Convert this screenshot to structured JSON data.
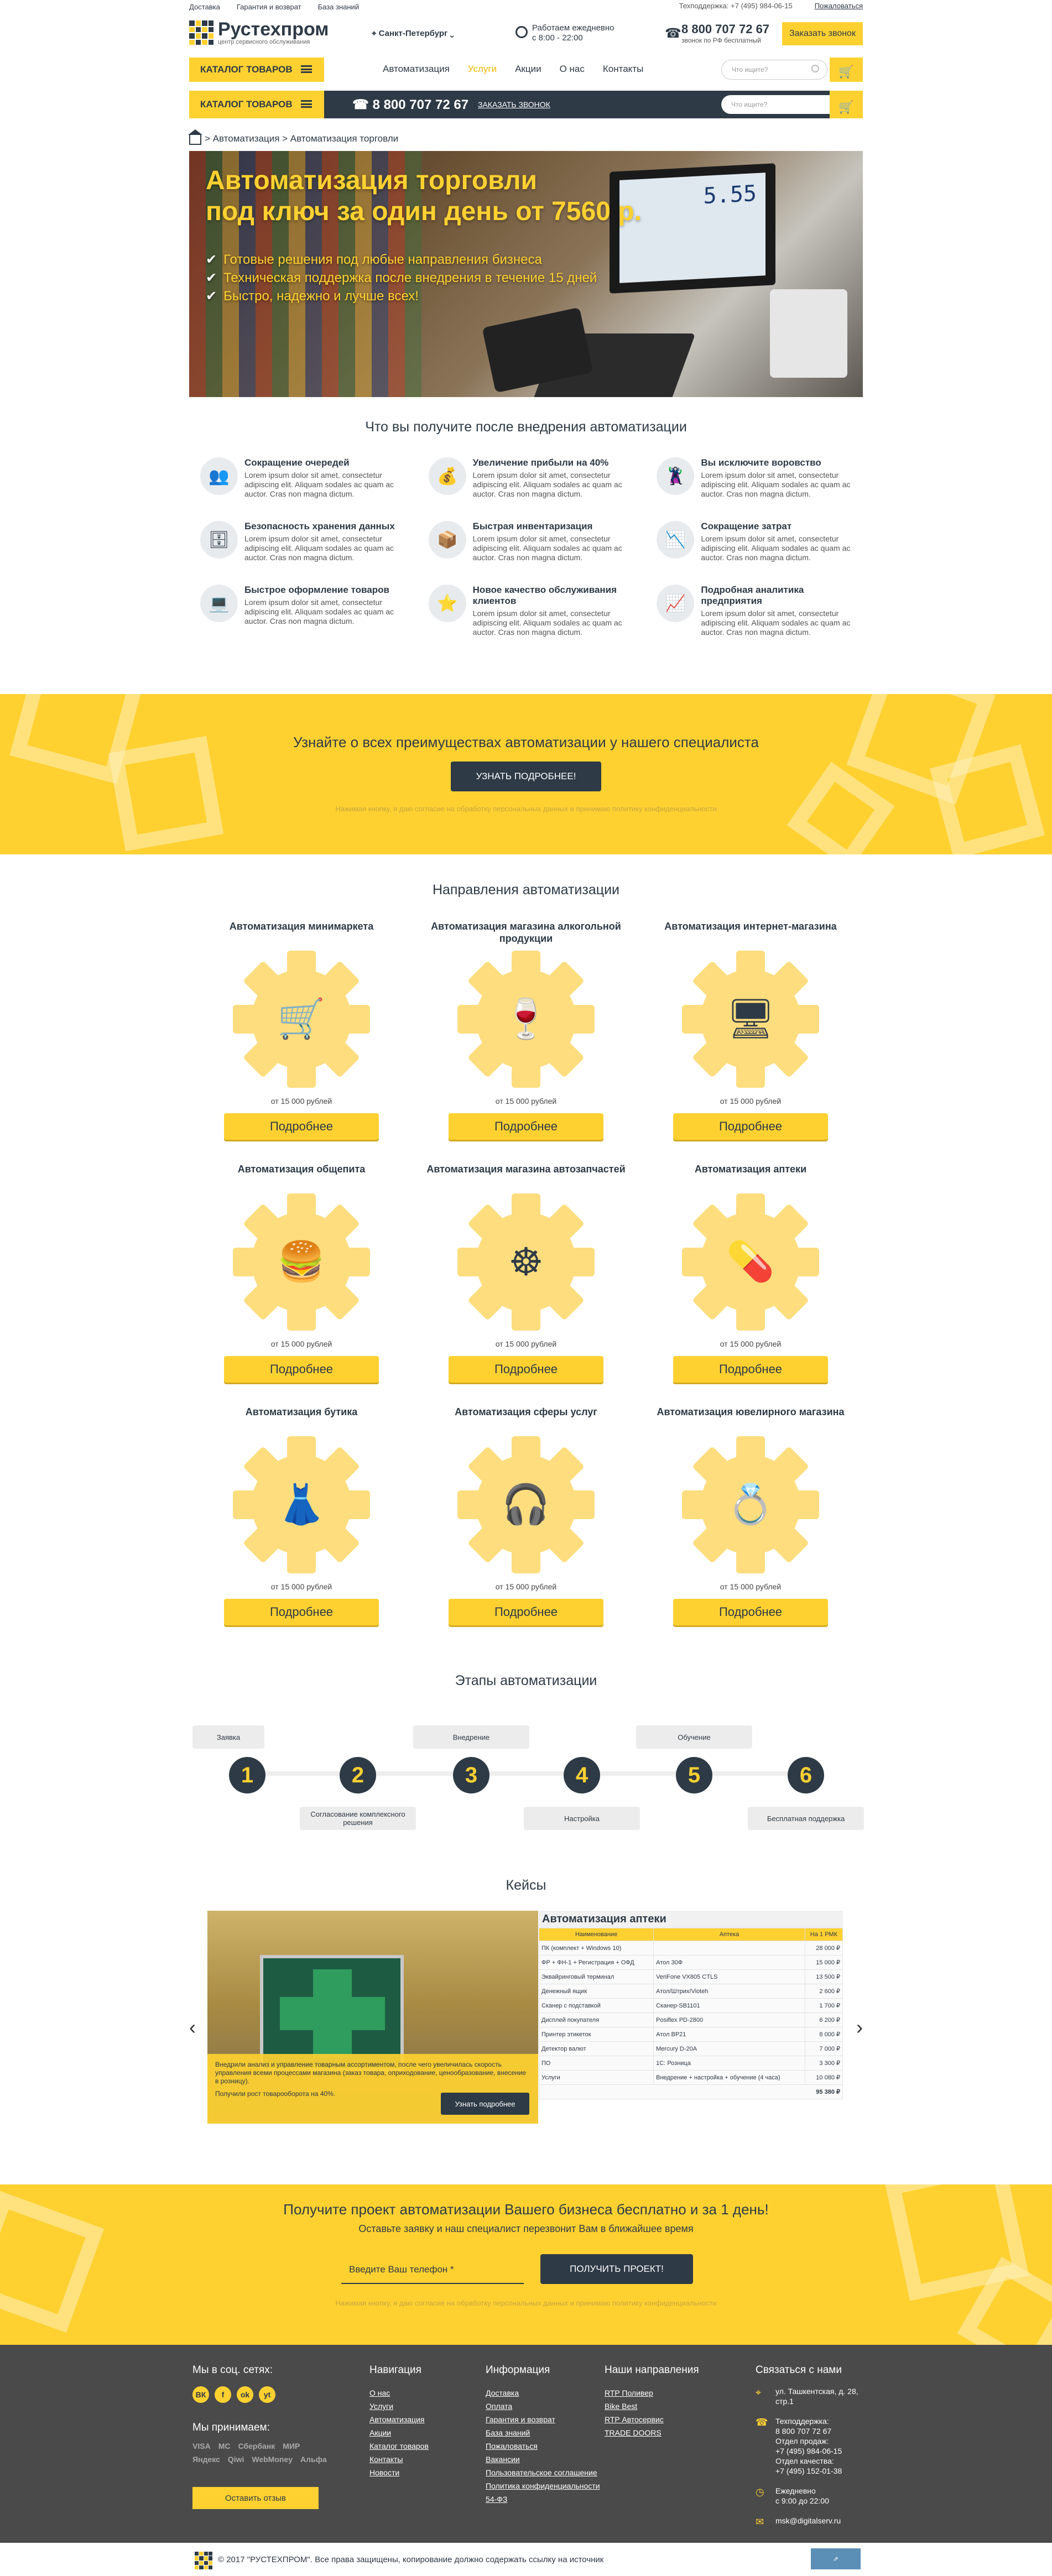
{
  "topbar": {
    "links": [
      "Доставка",
      "Гарантия и возврат",
      "База знаний"
    ],
    "support": "Техподдержка: +7 (495) 984-06-15",
    "complain": "Пожаловаться"
  },
  "header": {
    "logo_title": "Рустехпром",
    "logo_sub": "центр сервисного обслуживания",
    "city": "Санкт-Петербург",
    "hours_line1": "Работаем ежедневно",
    "hours_line2": "с 8:00 - 22:00",
    "phone": "8 800 707 72 67",
    "phone_note": "звонок по РФ бесплатный",
    "call_button": "Заказать звонок"
  },
  "nav": {
    "catalog": "КАТАЛОГ ТОВАРОВ",
    "items": [
      "Автоматизация",
      "Услуги",
      "Акции",
      "О нас",
      "Контакты"
    ],
    "active": "Услуги",
    "search_placeholder": "Что ищите?"
  },
  "sticky": {
    "catalog": "КАТАЛОГ ТОВАРОВ",
    "phone": "8 800 707 72 67",
    "callback": "ЗАКАЗАТЬ ЗВОНОК",
    "search_placeholder": "Что ищите?"
  },
  "breadcrumbs": {
    "path": "> Автоматизация > Автоматизация торговли"
  },
  "hero": {
    "title_line1": "Автоматизация торговли",
    "title_line2": "под ключ за один день от 7560 р.",
    "bullets": [
      "Готовые решения под любые направления бизнеса",
      "Техническая поддержка после внедрения в течение 15 дней",
      "Быстро, надежно и лучше всех!"
    ],
    "monitor_value": "5.55"
  },
  "benefits": {
    "title": "Что вы получите после внедрения автоматизации",
    "desc": "Lorem ipsum dolor sit amet, consectetur adipiscing elit. Aliquam sodales ac quam ac auctor. Cras non magna dictum.",
    "items": [
      {
        "title": "Сокращение очередей",
        "icon": "people-icon"
      },
      {
        "title": "Увеличение прибыли на 40%",
        "icon": "profit-icon"
      },
      {
        "title": "Вы исключите воровство",
        "icon": "thief-icon"
      },
      {
        "title": "Безопасность хранения данных",
        "icon": "database-lock-icon"
      },
      {
        "title": "Быстрая инвентаризация",
        "icon": "inventory-icon"
      },
      {
        "title": "Сокращение затрат",
        "icon": "cost-down-icon"
      },
      {
        "title": "Быстрое оформление товаров",
        "icon": "laptop-icon"
      },
      {
        "title": "Новое качество обслуживания клиентов",
        "icon": "stars-icon"
      },
      {
        "title": "Подробная аналитика предприятия",
        "icon": "chart-icon"
      }
    ]
  },
  "banner1": {
    "title": "Узнайте о всех преимуществах автоматизации у нашего специалиста",
    "button": "УЗНАТЬ ПОДРОБНЕЕ!",
    "note": "Нажимая кнопку, я даю согласие на обработку персональных данных и принимаю политику конфиденциальности"
  },
  "directions": {
    "title": "Направления автоматизации",
    "price": "от 15 000 рублей",
    "button": "Подробнее",
    "items": [
      {
        "title": "Автоматизация минимаркета",
        "icon": "cart-icon",
        "glyph": "🛒"
      },
      {
        "title": "Автоматизация магазина алкогольной продукции",
        "icon": "wine-icon",
        "glyph": "🍷"
      },
      {
        "title": "Автоматизация интернет-магазина",
        "icon": "monitor-cart-icon",
        "glyph": "🖥"
      },
      {
        "title": "Автоматизация общепита",
        "icon": "fastfood-icon",
        "glyph": "🍔"
      },
      {
        "title": "Автоматизация магазина автозапчастей",
        "icon": "steering-wheel-icon",
        "glyph": "☸"
      },
      {
        "title": "Автоматизация аптеки",
        "icon": "pills-icon",
        "glyph": "💊"
      },
      {
        "title": "Автоматизация бутика",
        "icon": "dress-icon",
        "glyph": "👗"
      },
      {
        "title": "Автоматизация сферы услуг",
        "icon": "operator-icon",
        "glyph": "🎧"
      },
      {
        "title": "Автоматизация ювелирного магазина",
        "icon": "rings-icon",
        "glyph": "💍"
      }
    ]
  },
  "steps": {
    "title": "Этапы автоматизации",
    "items": [
      {
        "n": "1",
        "label": "Заявка"
      },
      {
        "n": "2",
        "label": "Согласование комплексного решения"
      },
      {
        "n": "3",
        "label": "Внедрение"
      },
      {
        "n": "4",
        "label": "Настройка"
      },
      {
        "n": "5",
        "label": "Обучение"
      },
      {
        "n": "6",
        "label": "Бесплатная поддержка"
      }
    ]
  },
  "cases": {
    "title": "Кейсы",
    "case_title": "Автоматизация аптеки",
    "text": "Внедрили анализ и управление товарным ассортиментом, после чего увеличилась скорость управления всеми процессами магазина (заказ товара, оприходование, ценообразование, внесение в розницу).",
    "result": "Получили рост товарооборота на 40%.",
    "button": "Узнать подробнее",
    "headers": [
      "Наименование",
      "Аптека",
      "На 1 РМК"
    ],
    "rows": [
      [
        "ПК (комплект + Windows 10)",
        "",
        "28 000 ₽"
      ],
      [
        "ФР + ФН-1 + Регистрация + ОФД",
        "Атол 30Ф",
        "15 000 ₽"
      ],
      [
        "Эквайринговый терминал",
        "VeriFone VX805 CTLS",
        "13 500 ₽"
      ],
      [
        "Денежный ящик",
        "Атол/Штрих/Vioteh",
        "2 600 ₽"
      ],
      [
        "Сканер с подставкой",
        "Сканер-SB1101",
        "1 700 ₽"
      ],
      [
        "Дисплей покупателя",
        "Posiflex PD-2800",
        "6 200 ₽"
      ],
      [
        "Принтер этикеток",
        "Атол BP21",
        "8 000 ₽"
      ],
      [
        "Детектор валют",
        "Mercury D-20A",
        "7 000 ₽"
      ],
      [
        "ПО",
        "1С: Розница",
        "3 300 ₽"
      ],
      [
        "Услуги",
        "Внедрение + настройка + обучение (4 часа)",
        "10 080 ₽"
      ]
    ],
    "total": "95 380 ₽"
  },
  "banner2": {
    "title": "Получите проект автоматизации Вашего бизнеса бесплатно и за 1 день!",
    "subtitle": "Оставьте заявку и наш специалист перезвонит Вам в ближайшее время",
    "placeholder": "Введите Ваш телефон *",
    "button": "ПОЛУЧИТЬ ПРОЕКТ!",
    "note": "Нажимая кнопку, я даю согласие на обработку персональных данных и принимаю политику конфиденциальности"
  },
  "footer": {
    "social_title": "Мы в соц. сетях:",
    "social": [
      "ВК",
      "f",
      "ok",
      "yt"
    ],
    "pay_title": "Мы принимаем:",
    "pay": [
      "VISA",
      "MC",
      "Сбербанк",
      "МИР",
      "Яндекс",
      "Qiwi",
      "WebMoney",
      "Альфа"
    ],
    "review_button": "Оставить отзыв",
    "nav_title": "Навигация",
    "nav": [
      "О нас",
      "Услуги",
      "Автоматизация",
      "Акции",
      "Каталог товаров",
      "Контакты",
      "Новости"
    ],
    "info_title": "Информация",
    "info": [
      "Доставка",
      "Оплата",
      "Гарантия и возврат",
      "База знаний",
      "Пожаловаться",
      "Вакансии",
      "Пользовательское соглашение",
      "Политика конфиденциальности",
      "54-ФЗ"
    ],
    "brands_title": "Наши направления",
    "brands": [
      "RTP Поливер",
      "Bike Best",
      "RTP Автосервис",
      "TRADE DOORS"
    ],
    "contacts_title": "Связаться с нами",
    "address": "ул. Ташкентская, д. 28, стр.1",
    "support_label": "Техподдержка:",
    "support_phone": "8 800 707 72 67",
    "sales_label": "Отдел продаж:",
    "sales_phone": "+7 (495) 984-06-15",
    "quality_label": "Отдел качества:",
    "quality_phone": "+7 (495) 152-01-38",
    "work_label": "Ежедневно",
    "work_hours": "с 9:00 до 22:00",
    "email": "msk@digitalserv.ru"
  },
  "copyright": "© 2017 \"РУСТЕХПРОМ\". Все права защищены, копирование должно содержать ссылку на источник"
}
